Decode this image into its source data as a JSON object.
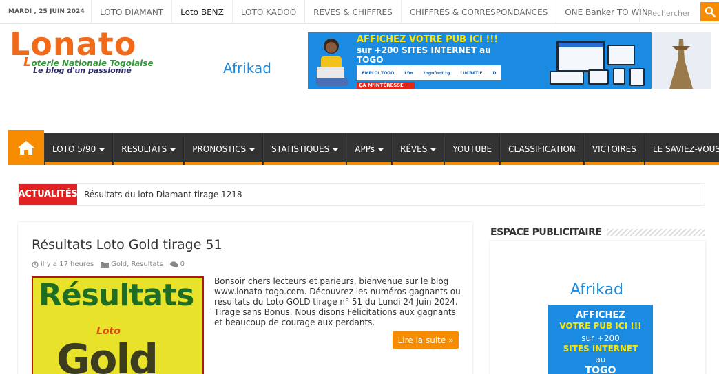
{
  "topbar": {
    "date": "MARDI , 25 JUIN 2024",
    "nav": [
      "LOTO DIAMANT",
      "Loto BENZ",
      "LOTO KADOO",
      "RÊVES & CHIFFRES",
      "CHIFFRES & CORRESPONDANCES",
      "ONE Banker TO WIN"
    ],
    "search_placeholder": "Rechercher",
    "search_icon": "search-icon"
  },
  "logo": {
    "brand": "Lonato",
    "subtitle_initial": "L",
    "subtitle_rest": "oterie Nationale Togolaise",
    "tagline": "Le blog d'un passionné"
  },
  "banner": {
    "brand_prefix": "Afrik",
    "brand_suffix": "ad",
    "headline": "AFFICHEZ VOTRE PUB ICI !!!",
    "line2": "sur +200 SITES INTERNET au",
    "line3": "TOGO",
    "partners": [
      "EMPLOI TOGO",
      "Lfm",
      "togofoot.tg",
      "LUCRATIF",
      "D"
    ],
    "cta": "ÇA M'INTÉRESSE"
  },
  "mainnav": {
    "home_icon": "home-icon",
    "items": [
      {
        "label": "LOTO 5/90",
        "dropdown": true
      },
      {
        "label": "RESULTATS",
        "dropdown": true
      },
      {
        "label": "PRONOSTICS",
        "dropdown": true
      },
      {
        "label": "STATISTIQUES",
        "dropdown": true
      },
      {
        "label": "APPs",
        "dropdown": true
      },
      {
        "label": "RÊVES",
        "dropdown": true
      },
      {
        "label": "YOUTUBE",
        "dropdown": false
      },
      {
        "label": "CLASSIFICATION",
        "dropdown": false
      },
      {
        "label": "VICTOIRES",
        "dropdown": false
      },
      {
        "label": "LE SAVIEZ-VOUS?",
        "dropdown": false
      }
    ]
  },
  "ticker": {
    "label": "ACTUALITÉS",
    "text": "Résultats du loto Diamant tirage 1218"
  },
  "post": {
    "title": "Résultats Loto Gold tirage 51",
    "time": "il y a 17 heures",
    "categories": "Gold, Resultats",
    "comments": "0",
    "thumb_word1": "Résultats",
    "thumb_word2": "Loto",
    "thumb_word3": "Gold",
    "excerpt": "Bonsoir chers lecteurs et parieurs, bienvenue sur le blog www.lonato-togo.com. Découvrez les numéros gagnants ou résultats du Loto GOLD tirage n° 51 du Lundi 24 Juin 2024. Tirage sans Bonus. Nous disons Félicitations aux gagnants et beaucoup de courage aux perdants.",
    "read_more": "Lire la suite »"
  },
  "sidebar": {
    "title": "ESPACE PUBLICITAIRE",
    "ad": {
      "brand_prefix": "Afrik",
      "brand_suffix": "ad",
      "l1": "AFFICHEZ",
      "l2": "VOTRE PUB ICI !!!",
      "l3": "sur +200",
      "l4": "SITES INTERNET",
      "l5": "au",
      "l6": "TOGO"
    }
  },
  "colors": {
    "accent": "#f88c00",
    "nav_bg": "#333333",
    "ticker_label": "#e02222",
    "logo_orange": "#f06a1a",
    "logo_green": "#2e9a36",
    "ad_blue": "#1a8be0"
  }
}
